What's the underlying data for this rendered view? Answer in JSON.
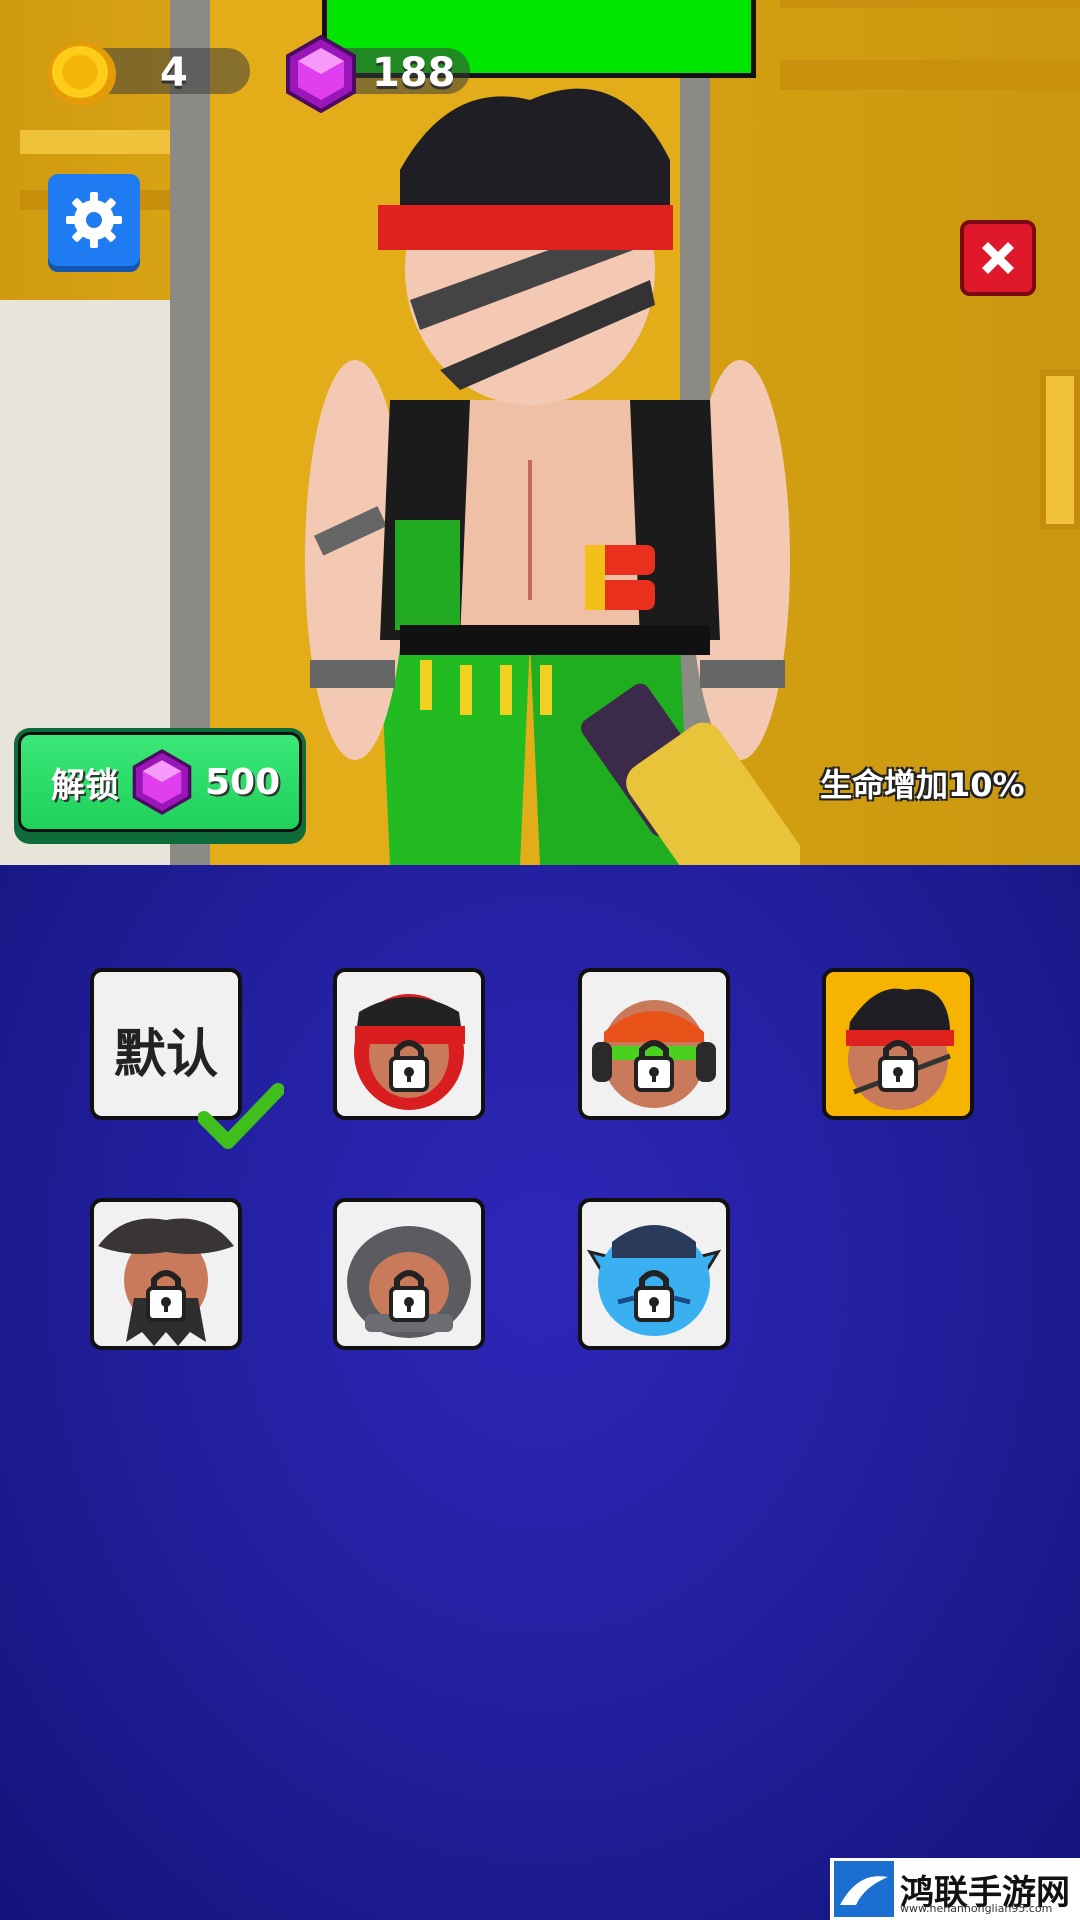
{
  "hud": {
    "coins": "4",
    "gems": "188"
  },
  "unlock_button": {
    "label": "解锁",
    "price": "500"
  },
  "bonus_text": "生命增加10%",
  "skins": [
    {
      "id": "default",
      "label": "默认",
      "selected": false,
      "locked": false,
      "equipped": true
    },
    {
      "id": "red-ninja",
      "locked": true
    },
    {
      "id": "headphones",
      "locked": true
    },
    {
      "id": "commando",
      "locked": true,
      "selected": true
    },
    {
      "id": "pirate",
      "locked": true
    },
    {
      "id": "helmet",
      "locked": true
    },
    {
      "id": "blue-cat",
      "locked": true
    }
  ],
  "watermark": {
    "title": "鸿联手游网",
    "url": "www.henanhonglian95.com"
  },
  "colors": {
    "health_bar": "#00e600",
    "panel": "#2220a0",
    "selected_tile": "#f6b400",
    "unlock_button": "#22d45e",
    "close_button": "#e0182b",
    "settings_button": "#1f7bf2"
  }
}
